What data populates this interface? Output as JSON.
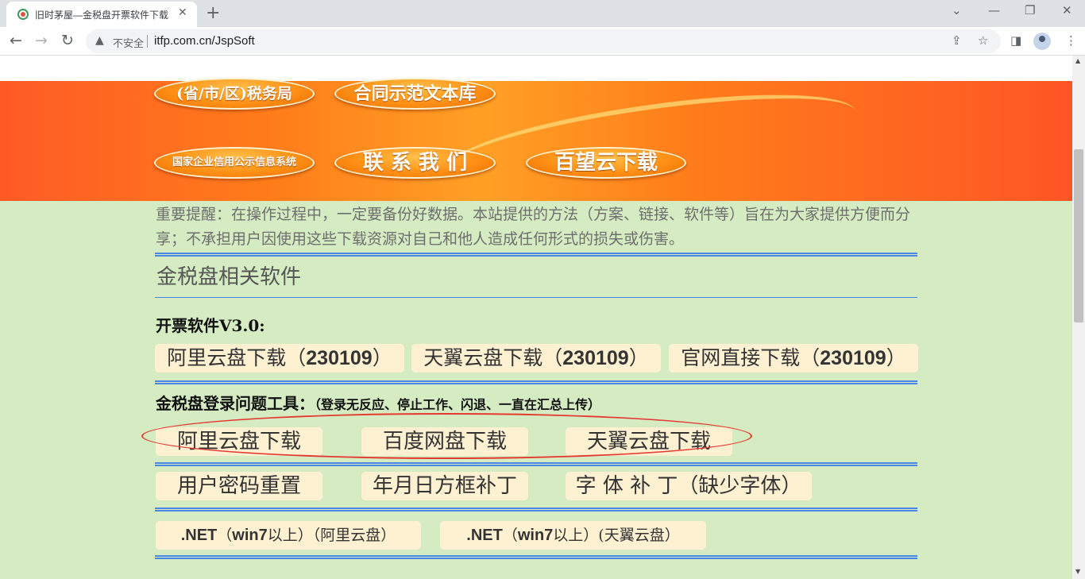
{
  "browser": {
    "tab_title": "旧时茅屋—金税盘开票软件下载",
    "tab_close": "✕",
    "new_tab": "+",
    "insecure_label": "不安全",
    "url": "itfp.com.cn/JspSoft"
  },
  "banner": {
    "buttons": [
      "(省/市/区)税务局",
      "合同示范文本库",
      "国家企业信用公示信息系统",
      "联 系 我 们",
      "百望云下载"
    ]
  },
  "page": {
    "notice": "重要提醒：在操作过程中，一定要备份好数据。本站提供的方法（方案、链接、软件等）旨在为大家提供方便而分享；不承担用户因使用这些下载资源对自己和他人造成任何形式的损失或伤害。",
    "section_title": "金税盘相关软件",
    "invoice_heading": "开票软件V3.0:",
    "invoice_links": [
      {
        "pre": "阿里云盘下载（",
        "num": "230109",
        "post": "）"
      },
      {
        "pre": "天翼云盘下载（",
        "num": "230109",
        "post": "）"
      },
      {
        "pre": "官网直接下载（",
        "num": "230109",
        "post": "）"
      }
    ],
    "login_heading": "金税盘登录问题工具：",
    "login_heading_note": "（登录无反应、停止工作、闪退、一直在汇总上传）",
    "login_links": [
      "阿里云盘下载",
      "百度网盘下载",
      "天翼云盘下载"
    ],
    "patch_links": [
      "用户密码重置",
      "年月日方框补丁",
      "字 体 补 丁（缺少字体）"
    ],
    "net_links": [
      {
        "pre": ".NET",
        "mid": "（",
        "win": "win7",
        "post": "以上）（阿里云盘）"
      },
      {
        "pre": ".NET",
        "mid": "（",
        "win": "win7",
        "post": "以上）(天翼云盘）"
      }
    ]
  },
  "icons": [
    "favicon-icon",
    "back-icon",
    "forward-icon",
    "reload-icon",
    "warning-icon",
    "share-icon",
    "star-icon",
    "sidepanel-icon",
    "profile-icon",
    "menu-icon"
  ]
}
